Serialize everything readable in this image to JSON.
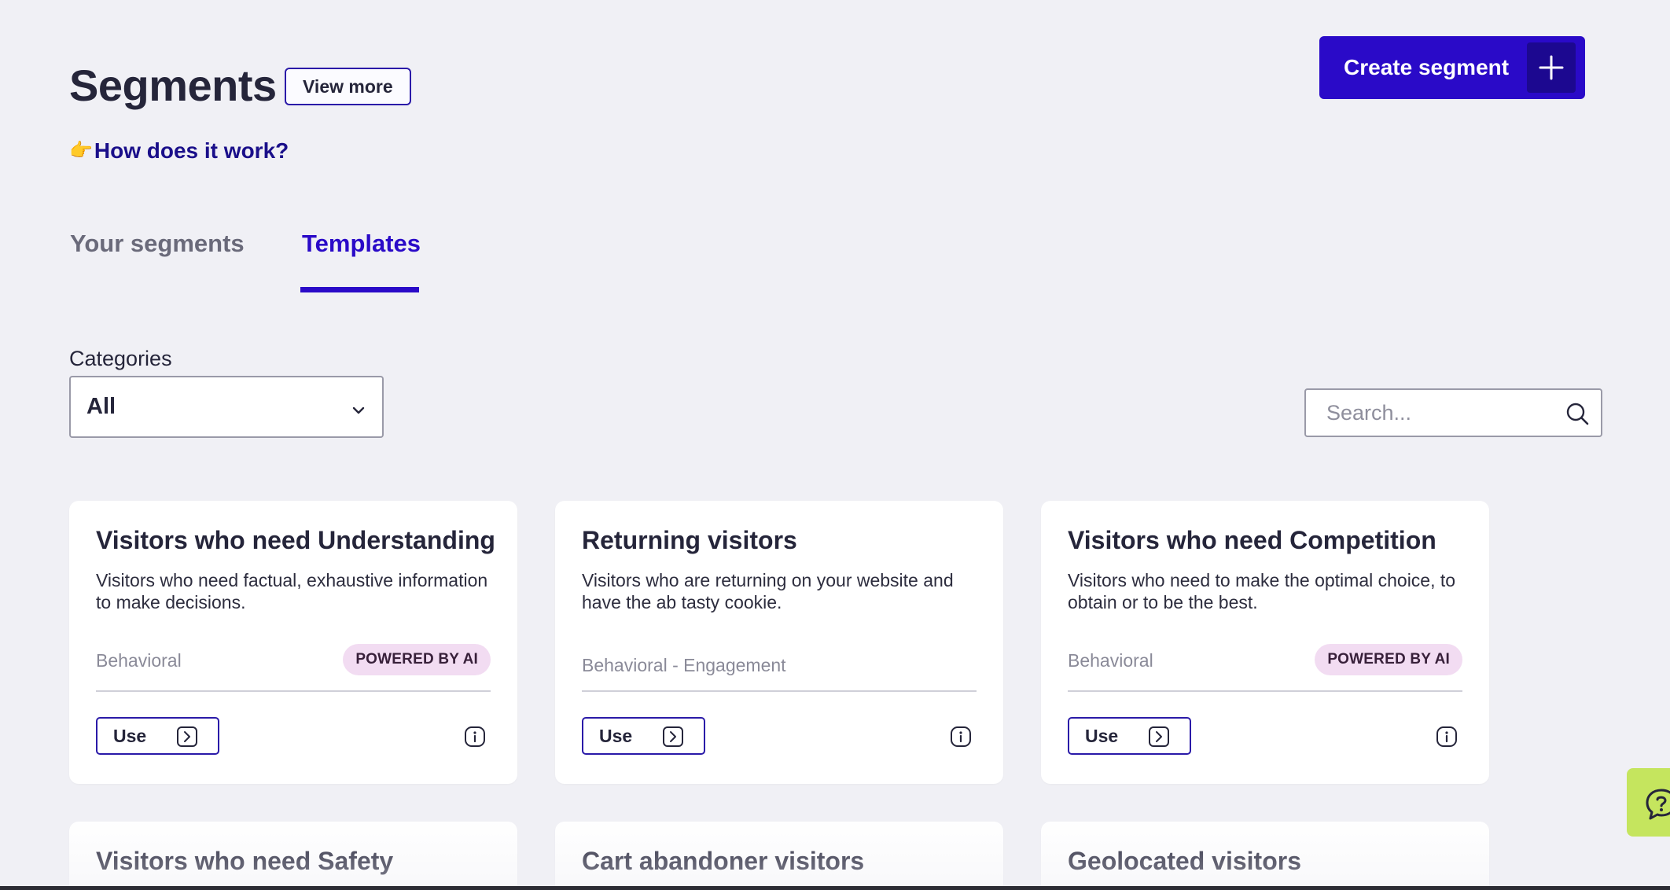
{
  "header": {
    "title": "Segments",
    "view_more_label": "View more",
    "how_link_emoji": "👉",
    "how_link_label": "How does it work?",
    "create_button_label": "Create segment"
  },
  "tabs": [
    {
      "label": "Your segments",
      "active": false
    },
    {
      "label": "Templates",
      "active": true
    }
  ],
  "filters": {
    "category_label": "Categories",
    "category_selected": "All",
    "search_placeholder": "Search..."
  },
  "cards": [
    {
      "title": "Visitors who need Understanding",
      "description": "Visitors who need factual, exhaustive information to make decisions.",
      "category": "Behavioral",
      "badge": "POWERED BY AI",
      "use_label": "Use"
    },
    {
      "title": "Returning visitors",
      "description": "Visitors who are returning on your website and have the ab tasty cookie.",
      "category": "Behavioral - Engagement",
      "badge": "",
      "use_label": "Use"
    },
    {
      "title": "Visitors who need Competition",
      "description": "Visitors who need to make the optimal choice, to obtain or to be the best.",
      "category": "Behavioral",
      "badge": "POWERED BY AI",
      "use_label": "Use"
    },
    {
      "title": "Visitors who need Safety"
    },
    {
      "title": "Cart abandoner visitors"
    },
    {
      "title": "Geolocated visitors"
    }
  ],
  "colors": {
    "primary": "#2a0ac8",
    "primary_dark": "#1c0890",
    "link": "#1a0f8a",
    "ai_badge_bg": "#f2dcf2",
    "help_tab": "#c5e55e",
    "page_bg": "#f0f0f5"
  },
  "icons": {
    "create": "plus-icon",
    "select": "chevron-down-icon",
    "search": "search-icon",
    "use": "arrow-right-box-icon",
    "info": "info-icon",
    "help": "help-chat-icon"
  }
}
